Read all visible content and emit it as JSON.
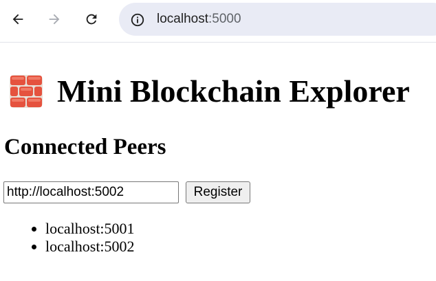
{
  "browser": {
    "url_host": "localhost",
    "url_port": ":5000",
    "accent_bg": "#e9ebf5"
  },
  "page": {
    "title": "Mini Blockchain Explorer",
    "title_icon": "brick-icon",
    "section_title": "Connected Peers",
    "peer_input": {
      "value": "http://localhost:5002",
      "placeholder": ""
    },
    "register_label": "Register",
    "peers": [
      "localhost:5001",
      "localhost:5002"
    ]
  }
}
